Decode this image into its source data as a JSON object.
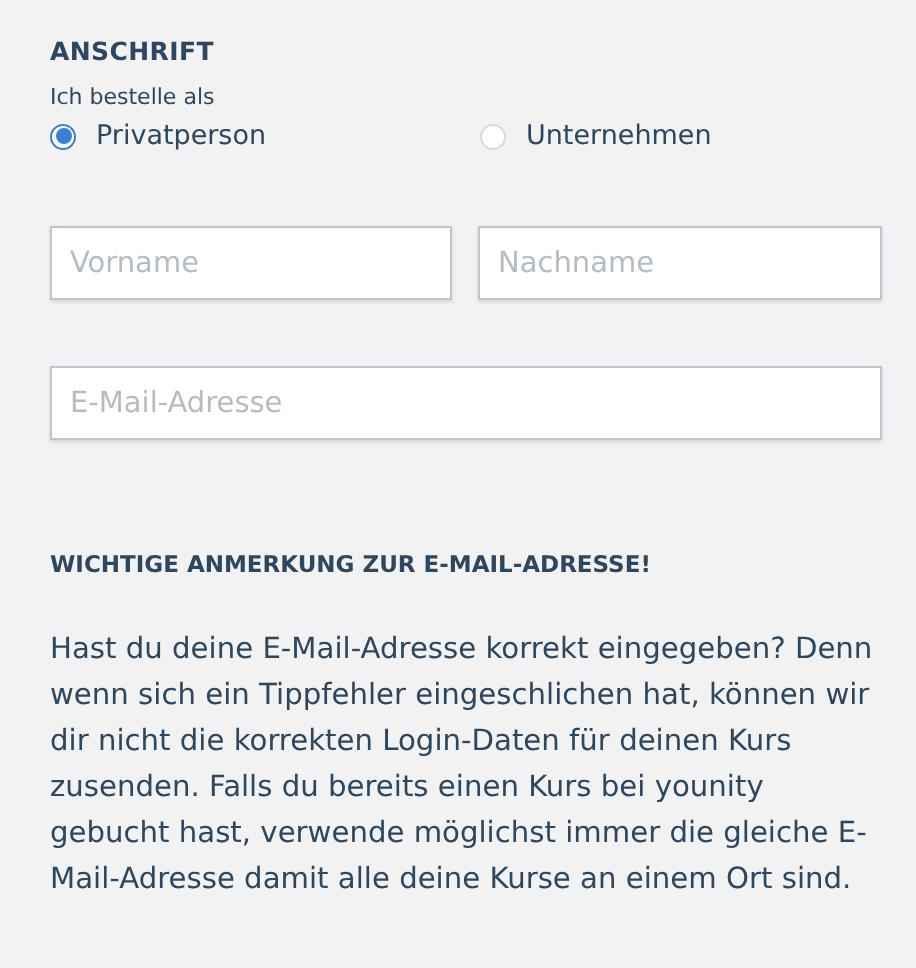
{
  "address_section": {
    "heading": "ANSCHRIFT",
    "order_as_label": "Ich bestelle als",
    "order_as_options": [
      {
        "label": "Privatperson",
        "selected": true
      },
      {
        "label": "Unternehmen",
        "selected": false
      }
    ],
    "name_fields": [
      {
        "placeholder": "Vorname"
      },
      {
        "placeholder": "Nachname"
      }
    ],
    "email_field": {
      "placeholder": "E-Mail-Adresse"
    }
  },
  "email_notice": {
    "heading": "WICHTIGE ANMERKUNG ZUR E-MAIL-ADRESSE!",
    "text": "Hast du deine E-Mail-Adresse korrekt eingegeben? Denn wenn sich ein Tippfehler eingeschlichen hat, können wir dir nicht die korrekten Login-Daten für deinen Kurs zusenden. Falls du bereits einen Kurs bei younity gebucht hast, verwende möglichst immer die gleiche E-Mail-Adresse damit alle deine Kurse an einem Ort sind."
  }
}
